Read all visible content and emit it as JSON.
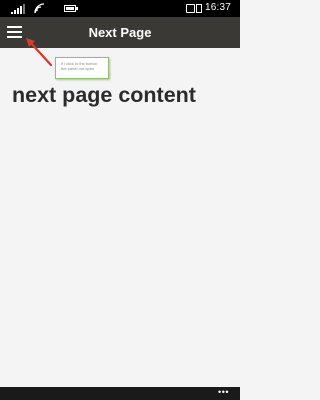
{
  "status_bar": {
    "time": "16:37",
    "icons": [
      "signal-icon",
      "wifi-icon",
      "battery-icon",
      "notification-icon",
      "sim-icon"
    ]
  },
  "header": {
    "title": "Next Page",
    "menu_icon": "hamburger-menu-icon",
    "background": "#3b3935"
  },
  "annotation": {
    "line1": "if i click in the button",
    "line2": "the panel not open",
    "arrow_color": "#d9392b",
    "border_color": "#8fc06a"
  },
  "content": {
    "heading": "next page content"
  },
  "bottom_bar": {
    "more_label": "•••"
  }
}
